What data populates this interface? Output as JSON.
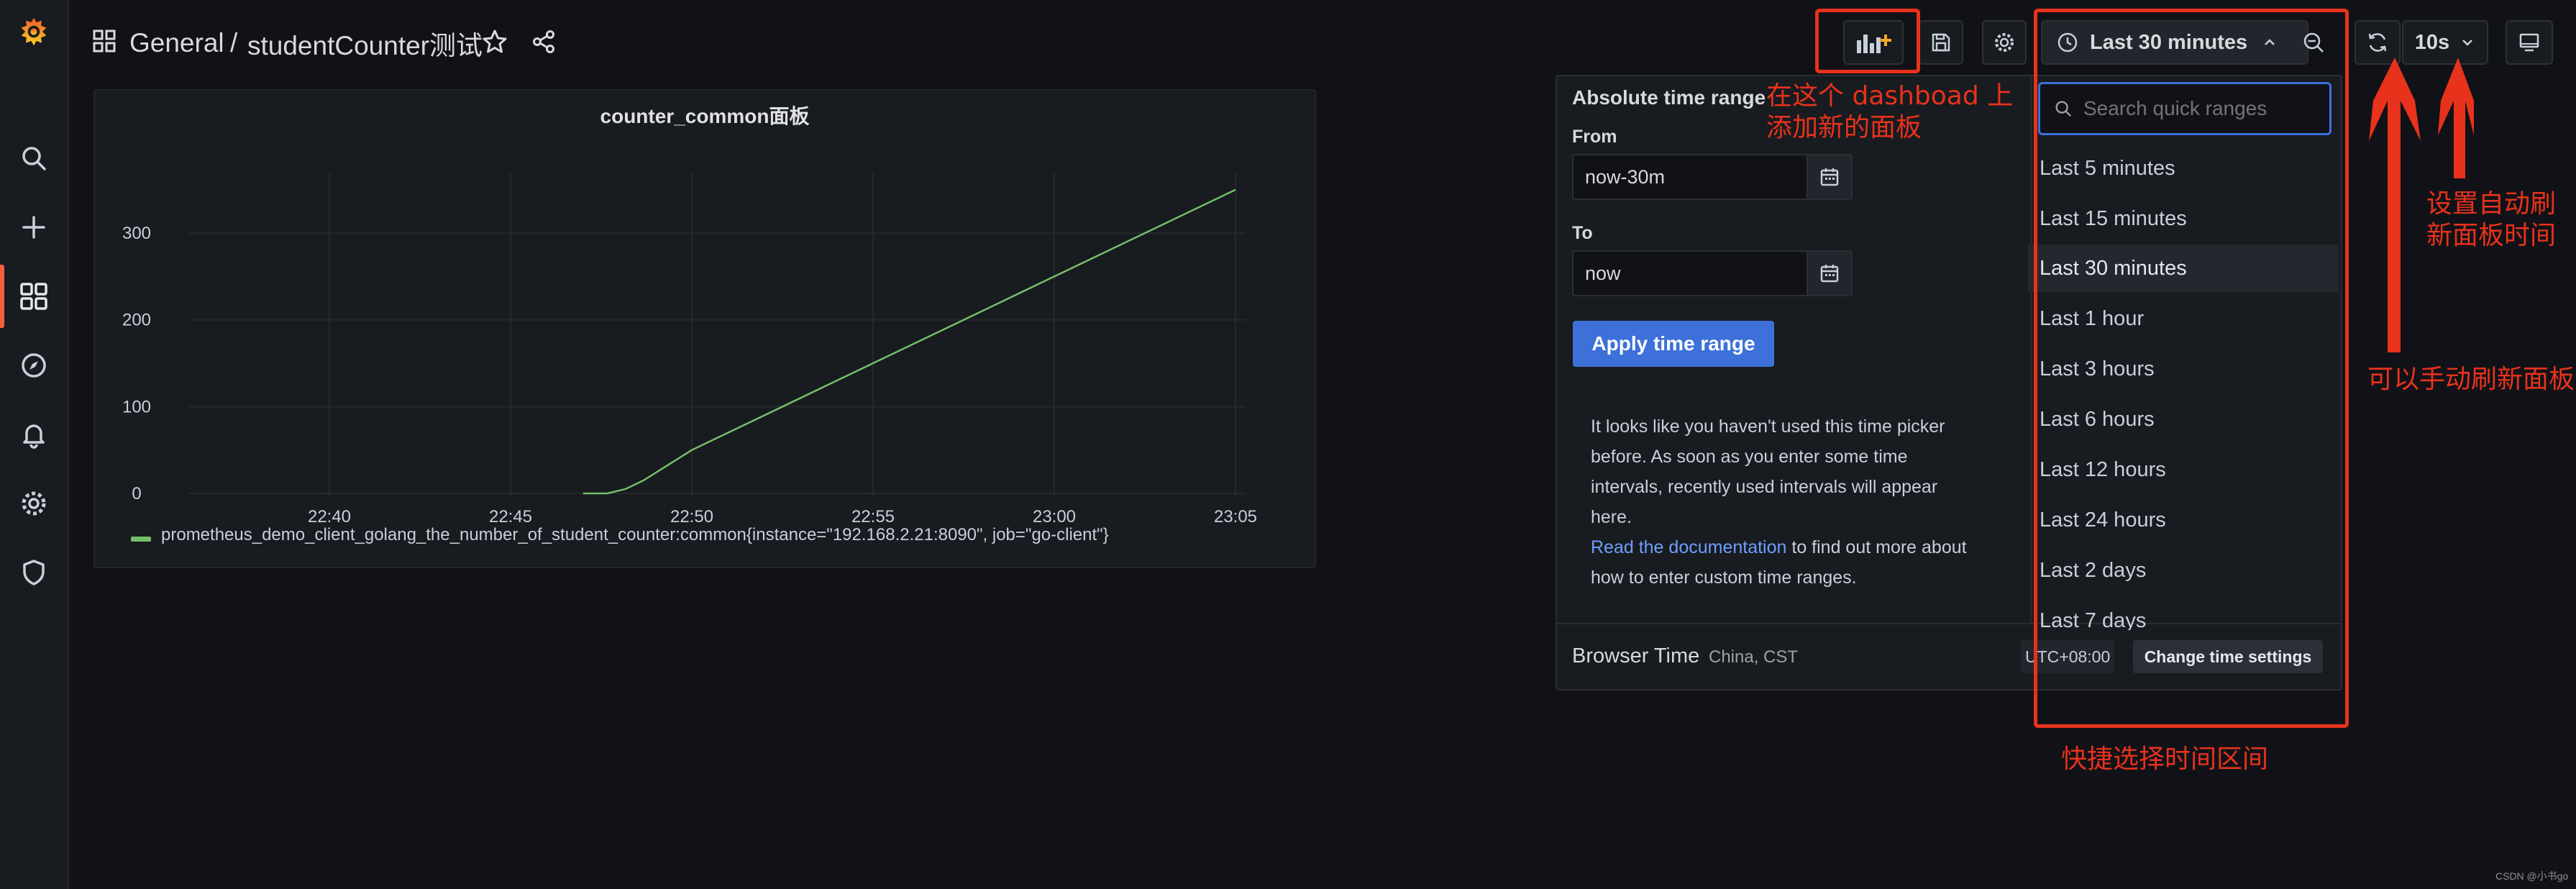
{
  "breadcrumb": {
    "folder": "General",
    "separator": "/",
    "dashboard": "studentCounter测试"
  },
  "toolbar": {
    "time_range_label": "Last 30 minutes",
    "refresh_interval": "10s"
  },
  "panel": {
    "title": "counter_common面板",
    "legend": "prometheus_demo_client_golang_the_number_of_student_counter:common{instance=\"192.168.2.21:8090\", job=\"go-client\"}"
  },
  "chart_data": {
    "type": "line",
    "title": "counter_common面板",
    "x_ticks": [
      "22:40",
      "22:45",
      "22:50",
      "22:55",
      "23:00",
      "23:05"
    ],
    "y_ticks": [
      "0",
      "100",
      "200",
      "300"
    ],
    "ylim": [
      0,
      360
    ],
    "grid": true,
    "legend_placement": "bottom-left",
    "series": [
      {
        "name": "prometheus_demo_client_golang_the_number_of_student_counter:common{instance=\"192.168.2.21:8090\", job=\"go-client\"}",
        "color": "#73bf69",
        "x": [
          "22:47:00",
          "22:47:40",
          "22:48:10",
          "22:48:40",
          "22:50:00",
          "22:55:00",
          "23:00:00",
          "23:05:00"
        ],
        "y": [
          0,
          0,
          5,
          15,
          50,
          150,
          250,
          350
        ]
      }
    ]
  },
  "time_picker": {
    "abs_title": "Absolute time range",
    "from_label": "From",
    "from_value": "now-30m",
    "to_label": "To",
    "to_value": "now",
    "apply": "Apply time range",
    "info_text": "It looks like you haven't used this time picker before. As soon as you enter some time intervals, recently used intervals will appear here.",
    "doc_link": "Read the documentation",
    "doc_suffix": " to find out more about how to enter custom time ranges.",
    "browser_time": "Browser Time",
    "timezone": "China, CST",
    "utc_offset": "UTC+08:00",
    "change_settings": "Change time settings",
    "search_placeholder": "Search quick ranges",
    "quick_ranges": [
      "Last 5 minutes",
      "Last 15 minutes",
      "Last 30 minutes",
      "Last 1 hour",
      "Last 3 hours",
      "Last 6 hours",
      "Last 12 hours",
      "Last 24 hours",
      "Last 2 days",
      "Last 7 days"
    ],
    "selected_range": "Last 30 minutes"
  },
  "annotations": {
    "add_panel": [
      "在这个 dashboad 上",
      "添加新的面板"
    ],
    "auto_refresh": [
      "设置自动刷",
      "新面板时间"
    ],
    "manual_refresh": "可以手动刷新面板",
    "quick_select": "快捷选择时间区间",
    "color": "#e8321c"
  },
  "watermark": "CSDN @小书go",
  "colors": {
    "background": "#111217",
    "accent": "#f55f3e",
    "primary_button": "#3d71d9",
    "series": "#73bf69"
  }
}
